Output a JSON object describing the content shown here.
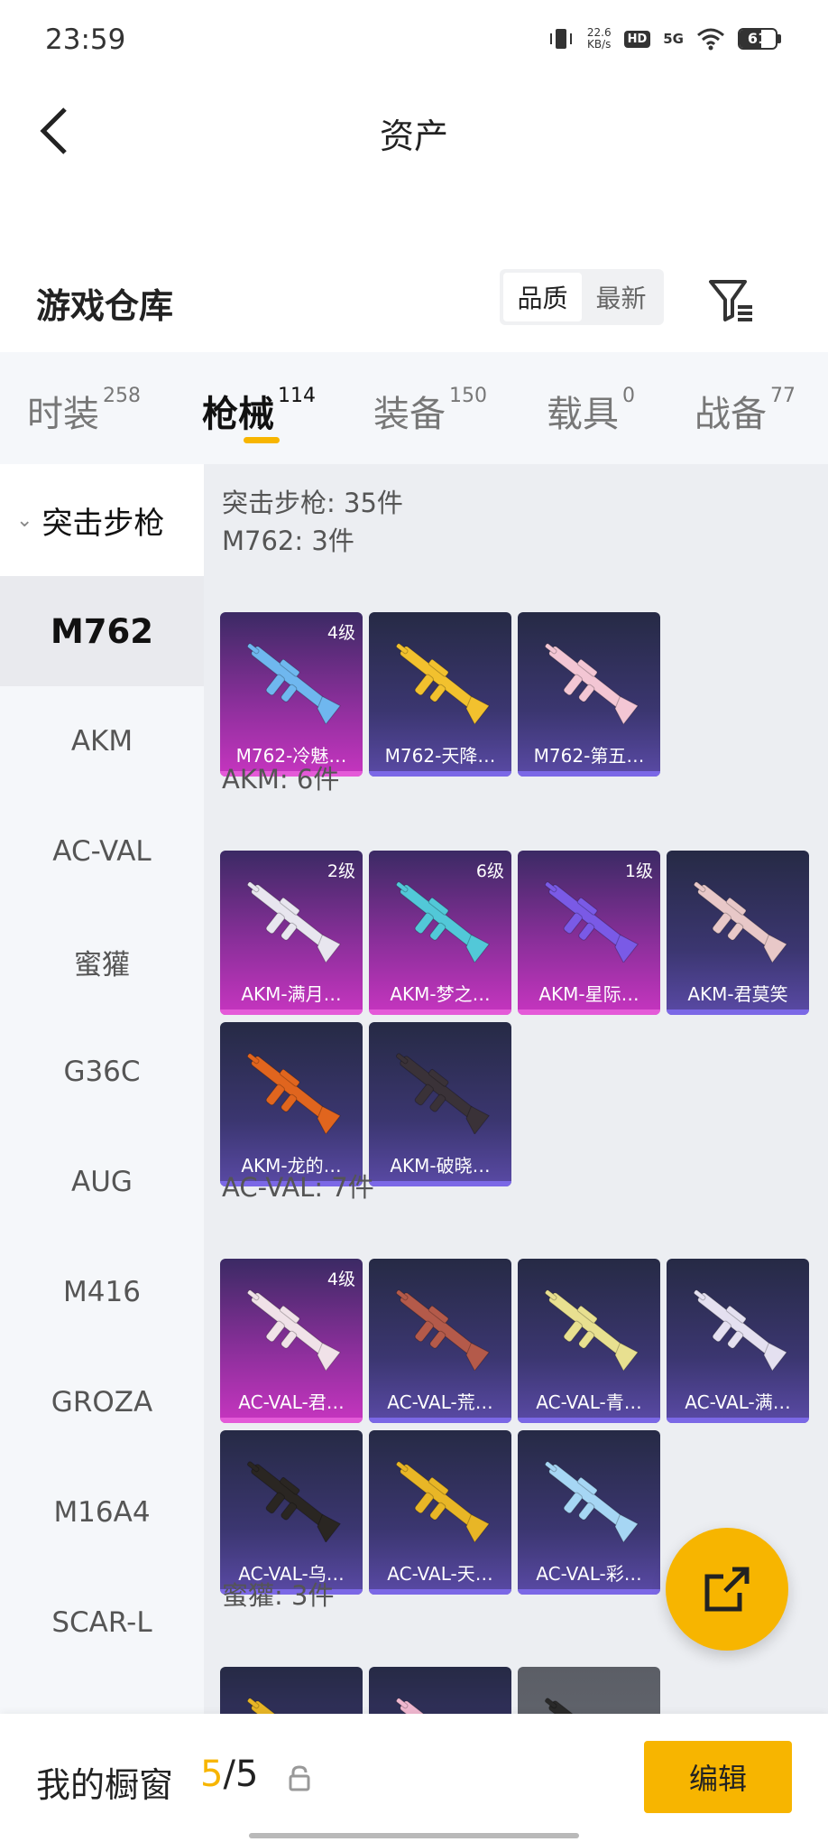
{
  "status_bar": {
    "time": "23:59",
    "net_speed_value": "22.6",
    "net_speed_unit": "KB/s",
    "hd_label": "HD",
    "network_label": "5G",
    "battery_level": "61",
    "battery_fraction": 0.61
  },
  "header": {
    "title": "资产"
  },
  "warehouse": {
    "title": "游戏仓库",
    "sort_options": [
      "品质",
      "最新"
    ],
    "sort_selected": "品质"
  },
  "tabs": [
    {
      "label": "时装",
      "count": "258"
    },
    {
      "label": "枪械",
      "count": "114",
      "active": true
    },
    {
      "label": "装备",
      "count": "150"
    },
    {
      "label": "载具",
      "count": "0"
    },
    {
      "label": "战备",
      "count": "77"
    }
  ],
  "sidebar": {
    "group_label": "突击步枪",
    "items": [
      "M762",
      "AKM",
      "AC-VAL",
      "蜜獾",
      "G36C",
      "AUG",
      "M416",
      "GROZA",
      "M16A4",
      "SCAR-L"
    ],
    "active_item": "M762"
  },
  "content": {
    "summary": "突击步枪: 35件",
    "sections": [
      {
        "title": "M762: 3件",
        "cards": [
          {
            "name": "M762-冷魅…",
            "level": "4级",
            "tier": "pink",
            "gun_color": "#6fb7ef"
          },
          {
            "name": "M762-天降…",
            "level": "",
            "tier": "purple",
            "gun_color": "#f2c12e"
          },
          {
            "name": "M762-第五…",
            "level": "",
            "tier": "purple",
            "gun_color": "#f3c6d4"
          }
        ]
      },
      {
        "title": "AKM: 6件",
        "cards": [
          {
            "name": "AKM-满月…",
            "level": "2级",
            "tier": "pink",
            "gun_color": "#e8e6ef"
          },
          {
            "name": "AKM-梦之…",
            "level": "6级",
            "tier": "pink",
            "gun_color": "#52c8d8"
          },
          {
            "name": "AKM-星际…",
            "level": "1级",
            "tier": "pink",
            "gun_color": "#7a5ae6"
          },
          {
            "name": "AKM-君莫笑",
            "level": "",
            "tier": "purple",
            "gun_color": "#e8c8c8"
          },
          {
            "name": "AKM-龙的…",
            "level": "",
            "tier": "purple",
            "gun_color": "#e0651e"
          },
          {
            "name": "AKM-破晓…",
            "level": "",
            "tier": "purple",
            "gun_color": "#3a3238"
          }
        ]
      },
      {
        "title": "AC-VAL: 7件",
        "cards": [
          {
            "name": "AC-VAL-君…",
            "level": "4级",
            "tier": "pink",
            "gun_color": "#f0e2e8"
          },
          {
            "name": "AC-VAL-荒…",
            "level": "",
            "tier": "purple",
            "gun_color": "#b45a4a"
          },
          {
            "name": "AC-VAL-青…",
            "level": "",
            "tier": "purple",
            "gun_color": "#e8e090"
          },
          {
            "name": "AC-VAL-满…",
            "level": "",
            "tier": "purple",
            "gun_color": "#e4e0f0"
          },
          {
            "name": "AC-VAL-乌…",
            "level": "",
            "tier": "purple",
            "gun_color": "#2a2622"
          },
          {
            "name": "AC-VAL-天…",
            "level": "",
            "tier": "purple",
            "gun_color": "#e8b626"
          },
          {
            "name": "AC-VAL-彩…",
            "level": "",
            "tier": "purple",
            "gun_color": "#a6d6f4"
          }
        ]
      },
      {
        "title": "蜜獾: 3件",
        "cards": [
          {
            "name": "",
            "level": "",
            "tier": "purple",
            "gun_color": "#e8b626"
          },
          {
            "name": "",
            "level": "",
            "tier": "purple",
            "gun_color": "#f0b8d0"
          },
          {
            "name": "",
            "level": "",
            "tier": "grey",
            "gun_color": "#2a2a2a"
          }
        ]
      }
    ]
  },
  "bottom_bar": {
    "label": "我的橱窗",
    "current": "5",
    "separator": "/",
    "total": "5",
    "edit_label": "编辑"
  }
}
